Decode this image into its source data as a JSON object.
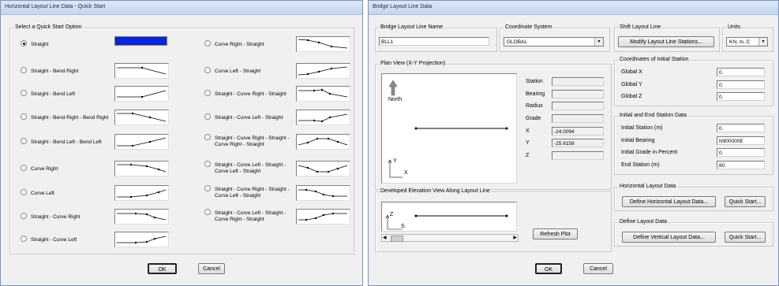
{
  "quick_start": {
    "title": "Horizontal Layout Line Data - Quick Start",
    "group_label": "Select a Quick Start Option",
    "options_left": [
      "Straight",
      "Straight - Bend Right",
      "Straight - Bend Left",
      "Straight - Bend Right - Bend Right",
      "Straight - Bend Left - Bend Left",
      "Curve Right",
      "Curve Left",
      "Straight - Curve Right",
      "Straight - Curve Left"
    ],
    "options_right": [
      [
        "Curve Right - Straight"
      ],
      [
        "Curve Left - Straight"
      ],
      [
        "Straight - Curve Right - Straight"
      ],
      [
        "Straight - Curve Left - Straight"
      ],
      [
        "Straight - Curve Right - Straight -",
        "Curve Right - Straight"
      ],
      [
        "Straight - Curve Left - Straight -",
        "Curve Left - Straight"
      ],
      [
        "Straight - Curve Right - Straight -",
        "Curve Left - Straight"
      ],
      [
        "Straight - Curve Left - Straight -",
        "Curve Right - Straight"
      ]
    ],
    "selected_option": "Straight",
    "ok_label": "OK",
    "cancel_label": "Cancel"
  },
  "bridge": {
    "title": "Bridge Layout Line Data",
    "name_group": "Bridge Layout Line Name",
    "name_value": "BLL1",
    "coord_group": "Coordinate System",
    "coord_value": "GLOBAL",
    "shift_group": "Shift Layout Line",
    "modify_label": "Modify Layout Line Stations...",
    "units_group": "Units",
    "units_value": "KN, m, C",
    "plan_group": "Plan View (X-Y Projection)",
    "north_label": "North",
    "plan_axis_y": "Y",
    "plan_axis_x": "X",
    "station_labels": [
      "Station",
      "Bearing",
      "Radius",
      "Grade",
      "X",
      "Y",
      "Z"
    ],
    "station_values": [
      "",
      "",
      "",
      "",
      "-24.0094",
      "-25.6158",
      ""
    ],
    "elev_group": "Developed Elevation View Along Layout Line",
    "elev_axis_z": "Z",
    "elev_axis_s": "S",
    "refresh_label": "Refresh Plot",
    "initial_group": "Coordinates of Initial Station",
    "initial_labels": [
      "Global X",
      "Global Y",
      "Global Z"
    ],
    "initial_values": [
      "0.",
      "0.",
      "0."
    ],
    "ie_group": "Initial and End Station Data",
    "ie_labels": [
      "Initial Station  (m)",
      "Initial Bearing",
      "Initial Grade in Percent",
      "End Station  (m)"
    ],
    "ie_values": [
      "0.",
      "N900000E",
      "0.",
      "80."
    ],
    "hz_group": "Horizontal Layout Data",
    "define_hz_label": "Define Horizontal Layout Data...",
    "quick_start_label": "Quick Start...",
    "vert_group": "Define Layout Data",
    "define_vert_label": "Define Vertical Layout Data...",
    "quick_start_label2": "Quick Start...",
    "ok_label": "OK",
    "cancel_label": "Cancel"
  }
}
